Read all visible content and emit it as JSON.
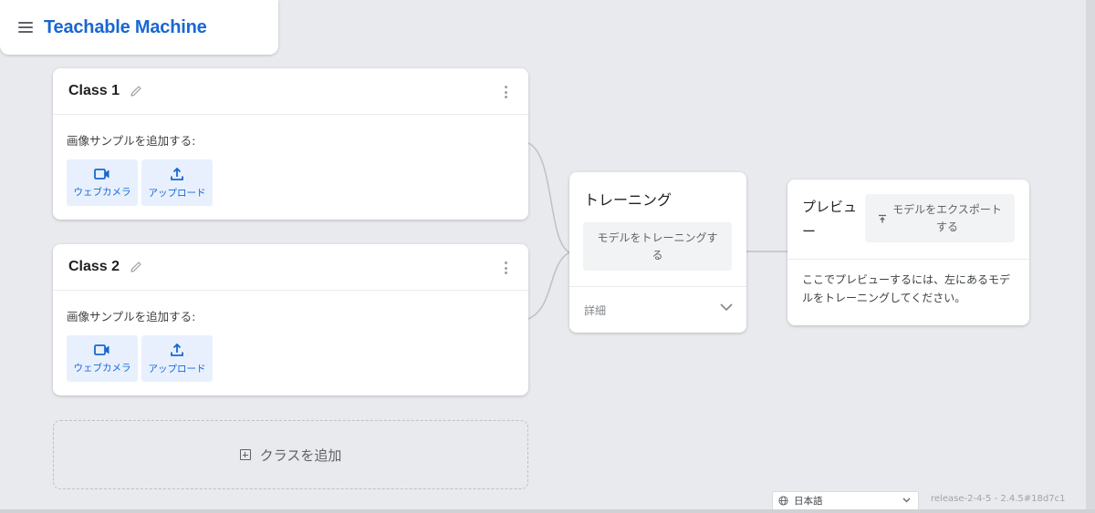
{
  "header": {
    "app_title": "Teachable Machine",
    "menu_icon": "hamburger-menu-icon"
  },
  "classes": [
    {
      "name": "Class 1",
      "sample_label": "画像サンプルを追加する:",
      "webcam_label": "ウェブカメラ",
      "upload_label": "アップロード"
    },
    {
      "name": "Class 2",
      "sample_label": "画像サンプルを追加する:",
      "webcam_label": "ウェブカメラ",
      "upload_label": "アップロード"
    }
  ],
  "add_class": {
    "label": "クラスを追加"
  },
  "training": {
    "title": "トレーニング",
    "train_button": "モデルをトレーニングする",
    "details_label": "詳細"
  },
  "preview": {
    "title": "プレビュー",
    "export_button": "モデルをエクスポートする",
    "message": "ここでプレビューするには、左にあるモデルをトレーニングしてください。"
  },
  "footer": {
    "language": "日本語",
    "release": "release-2-4-5 - 2.4.5#18d7c1"
  },
  "colors": {
    "accent": "#1967d2",
    "accent_bg": "#e8f0fe",
    "page_bg": "#e8eaed"
  }
}
